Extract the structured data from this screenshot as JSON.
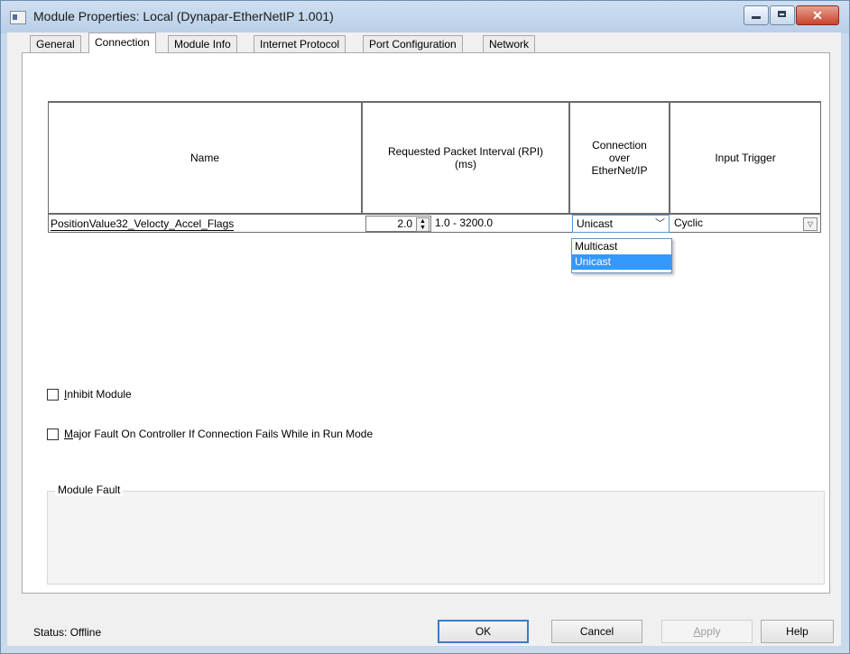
{
  "window": {
    "title": "Module Properties: Local (Dynapar-EtherNetIP 1.001)",
    "buttons": {
      "minimize": "–",
      "maximize": "□",
      "close": "✕"
    }
  },
  "tabs": [
    {
      "label": "General",
      "active": false
    },
    {
      "label": "Connection",
      "active": true
    },
    {
      "label": "Module Info",
      "active": false
    },
    {
      "label": "Internet Protocol",
      "active": false
    },
    {
      "label": "Port Configuration",
      "active": false
    },
    {
      "label": "Network",
      "active": false
    }
  ],
  "grid": {
    "columns": [
      "Name",
      "Requested Packet Interval (RPI) (ms)",
      "Connection over EtherNet/IP",
      "Input Trigger"
    ],
    "row": {
      "name": "PositionValue32_Velocty_Accel_Flags",
      "rpi_value": "2.0",
      "rpi_range": "1.0 - 3200.0",
      "connection": "Unicast",
      "input_trigger": "Cyclic"
    }
  },
  "connection_dropdown": {
    "options": [
      "Multicast",
      "Unicast"
    ],
    "selected": "Unicast"
  },
  "checkboxes": {
    "inhibit_first": "I",
    "inhibit_rest": "nhibit Module",
    "majorfault_first": "M",
    "majorfault_rest": "ajor Fault On Controller If Connection Fails While in Run Mode"
  },
  "module_fault": {
    "label": "Module Fault"
  },
  "status": "Status:  Offline",
  "footer_buttons": {
    "ok": "OK",
    "cancel": "Cancel",
    "apply_first": "A",
    "apply_rest": "pply",
    "help": "Help"
  },
  "icons": {
    "spin": "spin-updown-icon",
    "chevron": "chevron-down-icon"
  }
}
